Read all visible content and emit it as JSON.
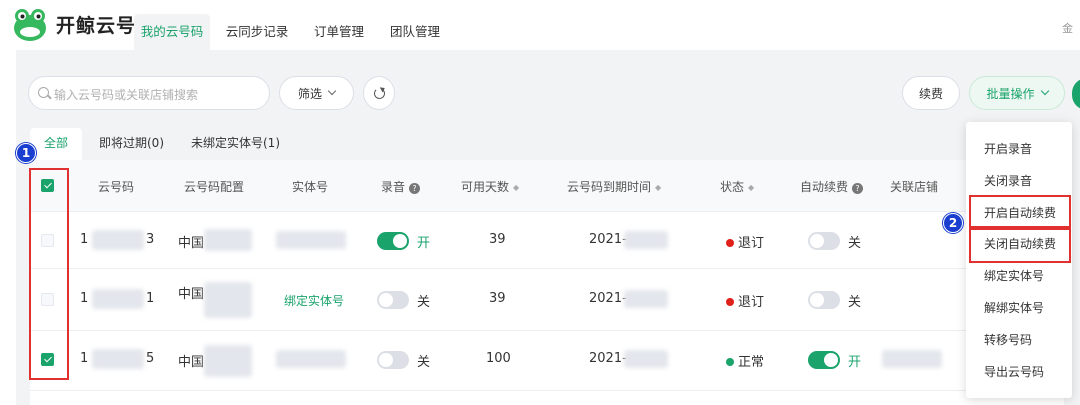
{
  "app": {
    "name": "开鲸云号",
    "top_right": "金"
  },
  "nav": {
    "tabs": [
      {
        "label": "我的云号码",
        "active": true
      },
      {
        "label": "云同步记录",
        "active": false
      },
      {
        "label": "订单管理",
        "active": false
      },
      {
        "label": "团队管理",
        "active": false
      }
    ]
  },
  "toolbar": {
    "search_placeholder": "输入云号码或关联店铺搜索",
    "filter_label": "筛选",
    "renew_label": "续费",
    "batch_label": "批量操作"
  },
  "subtabs": [
    {
      "label": "全部",
      "active": true
    },
    {
      "label": "即将过期(0)",
      "active": false
    },
    {
      "label": "未绑定实体号(1)",
      "active": false
    }
  ],
  "table": {
    "columns": [
      "云号码",
      "云号码配置",
      "实体号",
      "录音",
      "可用天数",
      "云号码到期时间",
      "状态",
      "自动续费",
      "关联店铺"
    ],
    "rows": [
      {
        "selected": false,
        "number_start": "1",
        "number_end": "3",
        "config": "中国",
        "entity": "",
        "recording_on": true,
        "recording_label": "开",
        "days": "39",
        "expiry": "2021-",
        "status": "退订",
        "status_color": "#e0201a",
        "auto_on": false,
        "auto_label": "关"
      },
      {
        "selected": false,
        "number_start": "1",
        "number_end": "1",
        "config": "中国",
        "entity": "绑定实体号",
        "recording_on": false,
        "recording_label": "关",
        "days": "39",
        "expiry": "2021-",
        "status": "退订",
        "status_color": "#e0201a",
        "auto_on": false,
        "auto_label": "关"
      },
      {
        "selected": true,
        "number_start": "1",
        "number_end": "5",
        "config": "中国",
        "entity": "",
        "recording_on": false,
        "recording_label": "关",
        "days": "100",
        "expiry": "2021-",
        "status": "正常",
        "status_color": "#1aa36b",
        "auto_on": true,
        "auto_label": "开"
      }
    ]
  },
  "dropdown": {
    "items": [
      "开启录音",
      "关闭录音",
      "开启自动续费",
      "关闭自动续费",
      "绑定实体号",
      "解绑实体号",
      "转移号码",
      "导出云号码"
    ]
  },
  "annotations": {
    "badge1": "1",
    "badge2": "2"
  },
  "colors": {
    "accent": "#1aa36b",
    "highlight": "#e03030",
    "badge": "#1a3fd0"
  }
}
